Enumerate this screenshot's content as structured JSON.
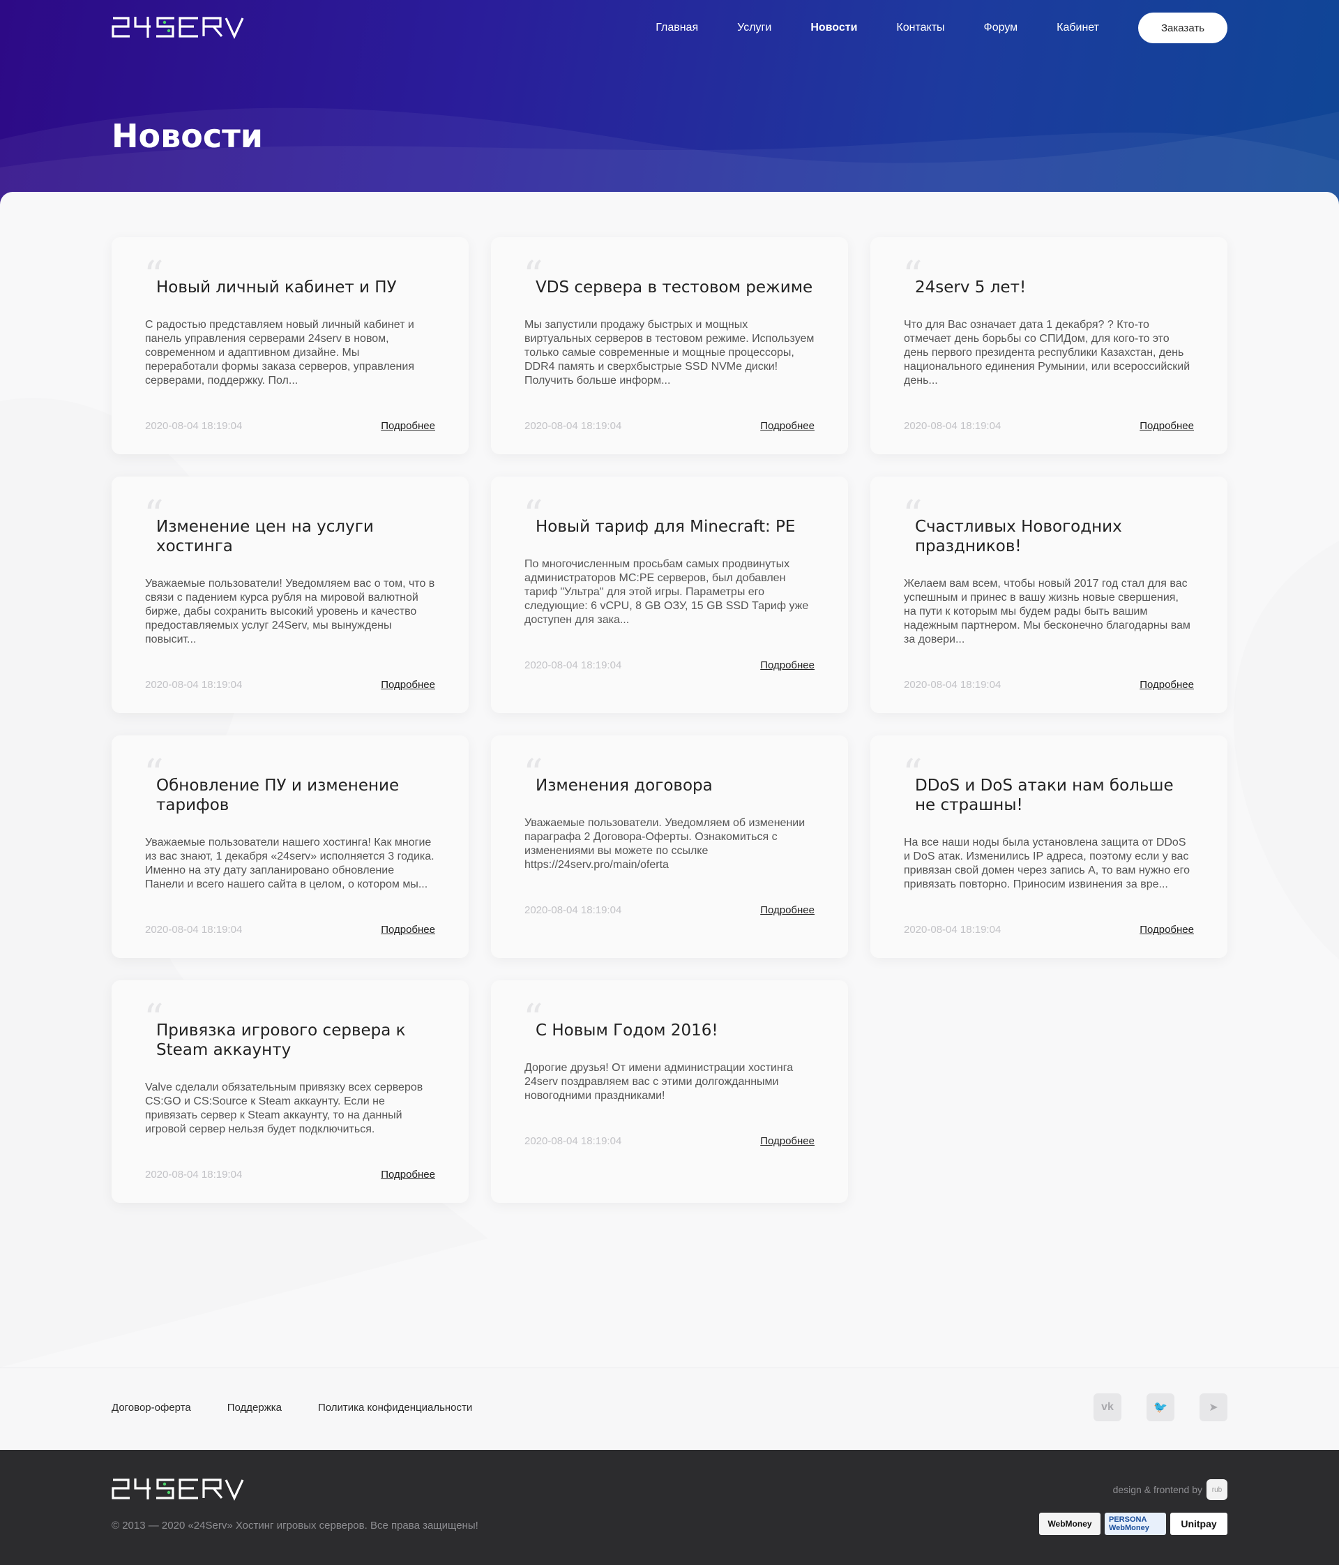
{
  "header": {
    "logo_alt": "24SERV",
    "nav": [
      {
        "label": "Главная",
        "active": false
      },
      {
        "label": "Услуги",
        "active": false
      },
      {
        "label": "Новости",
        "active": true
      },
      {
        "label": "Контакты",
        "active": false
      },
      {
        "label": "Форум",
        "active": false
      },
      {
        "label": "Кабинет",
        "active": false
      }
    ],
    "order_button": "Заказать",
    "page_title": "Новости"
  },
  "news": [
    {
      "title": "Новый личный кабинет и ПУ",
      "text": "С радостью представляем новый личный кабинет и панель управления серверами 24serv в новом, современном и адаптивном дизайне. Мы переработали формы заказа серверов, управления серверами, поддержку. Пол...",
      "date": "2020-08-04 18:19:04",
      "more": "Подробнее"
    },
    {
      "title": "VDS сервера в тестовом режиме",
      "text": "Мы запустили продажу быстрых и мощных виртуальных серверов в тестовом режиме. Используем только самые современные и мощные процессоры, DDR4 память и сверхбыстрые SSD NVMe диски! Получить больше информ...",
      "date": "2020-08-04 18:19:04",
      "more": "Подробнее"
    },
    {
      "title": "24serv 5 лет!",
      "text": "Что для Вас означает дата 1 декабря? ? Кто-то отмечает день борьбы со СПИДом, для кого-то это день первого президента республики Казахстан, день национального единения Румынии, или всероссийский день...",
      "date": "2020-08-04 18:19:04",
      "more": "Подробнее"
    },
    {
      "title": "Изменение цен на услуги хостинга",
      "text": "Уважаемые пользователи! Уведомляем вас о том, что в связи с падением курса рубля на мировой валютной бирже, дабы сохранить высокий уровень и качество предоставляемых услуг 24Serv, мы вынуждены повысит...",
      "date": "2020-08-04 18:19:04",
      "more": "Подробнее"
    },
    {
      "title": "Новый тариф для Minecraft: PE",
      "text": "По многочисленным просьбам самых продвинутых администраторов MC:PE серверов, был добавлен тариф \"Ультра\" для этой игры. Параметры его следующие: 6 vCPU, 8 GB ОЗУ, 15 GB SSD Тариф уже доступен для зака...",
      "date": "2020-08-04 18:19:04",
      "more": "Подробнее"
    },
    {
      "title": "Счастливых Новогодних праздников!",
      "text": "Желаем вам всем, чтобы новый 2017 год стал для вас успешным и принес в вашу жизнь новые свершения, на пути к которым мы будем рады быть вашим надежным партнером. Мы бесконечно благодарны вам за довери...",
      "date": "2020-08-04 18:19:04",
      "more": "Подробнее"
    },
    {
      "title": "Обновление ПУ и изменение тарифов",
      "text": "Уважаемые пользователи нашего хостинга! Как многие из вас знают, 1 декабря «24serv» исполняется 3 годика. Именно на эту дату запланировано обновление Панели и всего нашего сайта в целом, о котором мы...",
      "date": "2020-08-04 18:19:04",
      "more": "Подробнее"
    },
    {
      "title": "Изменения договора",
      "text": "Уважаемые пользователи. Уведомляем об изменении параграфа 2 Договора-Оферты. Ознакомиться с изменениями вы можете по ссылке https://24serv.pro/main/oferta",
      "date": "2020-08-04 18:19:04",
      "more": "Подробнее"
    },
    {
      "title": "DDoS и DoS атаки нам больше не страшны!",
      "text": "На все наши ноды была установлена защита от DDoS и DoS атак. Изменились IP адреса, поэтому если у вас привязан свой домен через запись А, то вам нужно его привязать повторно. Приносим извинения за вре...",
      "date": "2020-08-04 18:19:04",
      "more": "Подробнее"
    },
    {
      "title": "Привязка игрового сервера к Steam аккаунту",
      "text": "Valve сделали обязательным привязку всех серверов CS:GO и CS:Source к Steam аккаунту. Если не привязать сервер к Steam аккаунту, то на данный игровой сервер нельзя будет подключиться.",
      "date": "2020-08-04 18:19:04",
      "more": "Подробнее"
    },
    {
      "title": "С Новым Годом 2016!",
      "text": "Дорогие друзья! От имени администрации хостинга 24serv поздравляем вас с этими долгожданными новогодними праздниками!",
      "date": "2020-08-04 18:19:04",
      "more": "Подробнее"
    }
  ],
  "footer": {
    "links": [
      "Договор-оферта",
      "Поддержка",
      "Политика конфиденциальности"
    ],
    "socials": [
      {
        "icon": "vk-icon",
        "glyph": "vk"
      },
      {
        "icon": "twitter-icon",
        "glyph": "🐦"
      },
      {
        "icon": "telegram-icon",
        "glyph": "➤"
      }
    ],
    "copyright": "© 2013 — 2020 «24Serv» Хостинг игровых серверов. Все права защищены!",
    "design_by": "design & frontend by",
    "payments": [
      "WebMoney",
      "PERSONA WebMoney",
      "Unitpay"
    ]
  },
  "colors": {
    "hero_start": "#2d0a86",
    "hero_end": "#0f4696",
    "accent_green": "#4cd46a",
    "footer_dark": "#2c2c2e"
  }
}
